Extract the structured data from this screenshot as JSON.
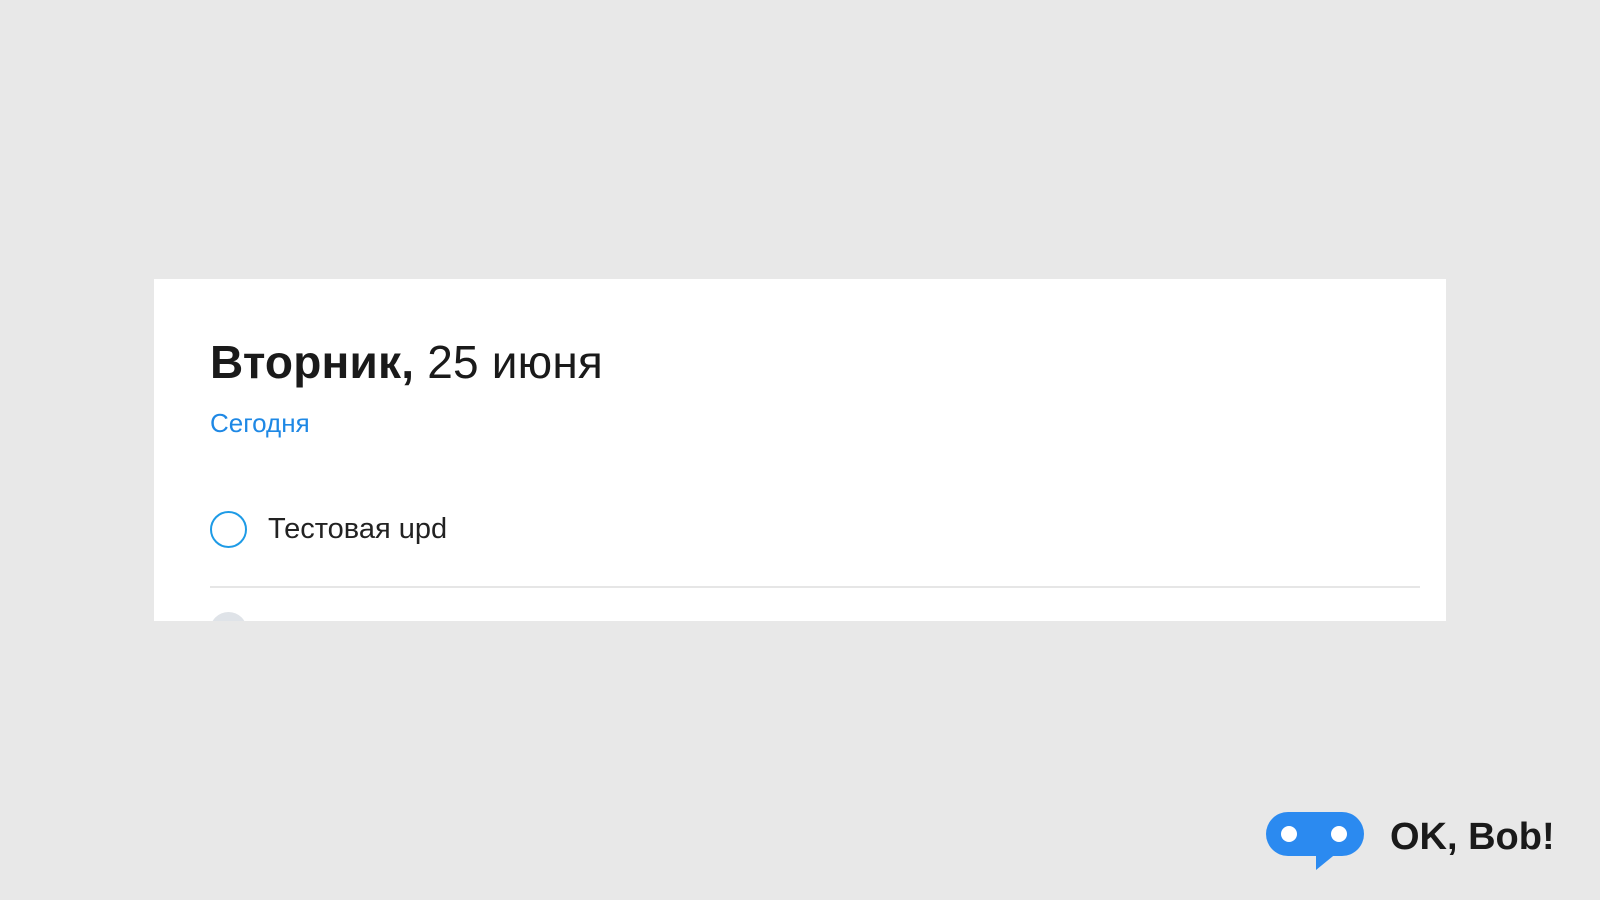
{
  "day": {
    "weekday": "Вторник,",
    "date": "25 июня",
    "today_label": "Сегодня"
  },
  "tasks": [
    {
      "label": "Тестовая upd",
      "completed": false
    }
  ],
  "brand": {
    "name": "OK, Bob!",
    "logo_icon": "speech-bubble-robot-icon"
  },
  "colors": {
    "accent": "#1e88e5",
    "checkbox_border": "#1e9be6",
    "logo": "#2b8af0",
    "background": "#e8e8e8"
  }
}
